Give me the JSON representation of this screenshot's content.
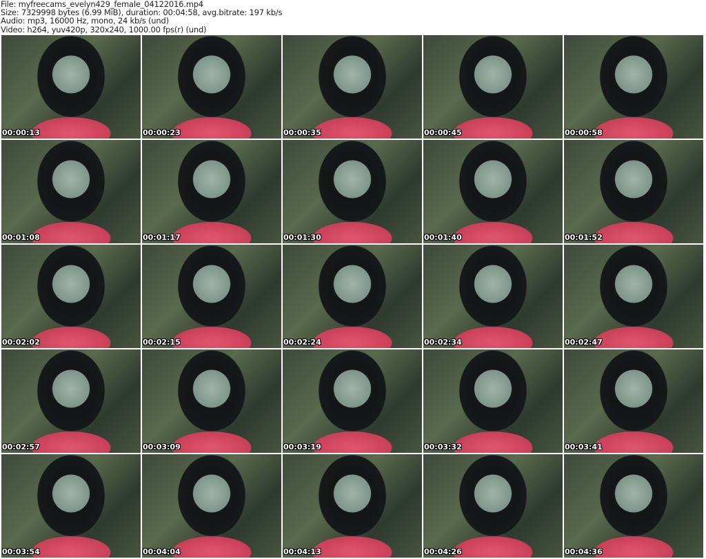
{
  "header": {
    "file": "File: myfreecams_evelyn429_female_04122016.mp4",
    "size": "Size: 7329998 bytes (6.99 MiB), duration: 00:04:58, avg.bitrate: 197 kb/s",
    "audio": "Audio: mp3, 16000 Hz, mono, 24 kb/s (und)",
    "video": "Video: h264, yuv420p, 320x240, 1000.00 fps(r) (und)"
  },
  "timestamps": [
    "00:00:13",
    "00:00:23",
    "00:00:35",
    "00:00:45",
    "00:00:58",
    "00:01:08",
    "00:01:17",
    "00:01:30",
    "00:01:40",
    "00:01:52",
    "00:02:02",
    "00:02:15",
    "00:02:24",
    "00:02:34",
    "00:02:47",
    "00:02:57",
    "00:03:09",
    "00:03:19",
    "00:03:32",
    "00:03:41",
    "00:03:54",
    "00:04:04",
    "00:04:13",
    "00:04:26",
    "00:04:36"
  ]
}
